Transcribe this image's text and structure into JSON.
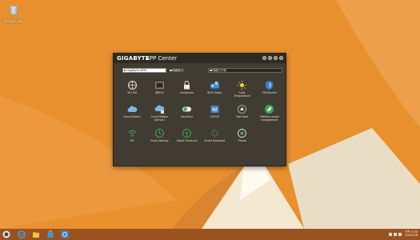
{
  "desktop": {
    "icons": [
      {
        "name": "recycle-bin-icon",
        "label": "Recycle Bin"
      }
    ],
    "wallpaper_colors": {
      "orange": "#e9902e",
      "cream": "#f6ecd8",
      "white": "#fffaf0"
    }
  },
  "window": {
    "brand": "GIGABYTE",
    "title": "APP Center",
    "controls": [
      "settings",
      "help",
      "minimize",
      "close"
    ],
    "filter": {
      "dropdown_value": "Gigabyte APPs",
      "options": [
        "隱藏程式",
        "隱藏已升級"
      ]
    },
    "apps": [
      [
        {
          "icon": "film-reel-icon",
          "label": "3D OSD"
        },
        {
          "icon": "bios-chip-icon",
          "label": "@BIOS"
        },
        {
          "icon": "padlock-icon",
          "label": "AutoGreen"
        },
        {
          "icon": "bios-setup-icon",
          "label": "BIOS Setup"
        },
        {
          "icon": "sun-temperature-icon",
          "label": "Color\nTemperature"
        },
        {
          "icon": "shield-icon",
          "label": "EIN Blocker"
        }
      ],
      [
        {
          "icon": "cloud-icon",
          "label": "Cloud Station"
        },
        {
          "icon": "cloud-server-icon",
          "label": "Cloud Station\n(Server)"
        },
        {
          "icon": "toggle-icon",
          "label": "EasyTune"
        },
        {
          "icon": "ez-icon",
          "label": "LIVEUD"
        },
        {
          "icon": "fast-boot-icon",
          "label": "Fast Boot"
        },
        {
          "icon": "leaf-icon",
          "label": "Platform power\nmanagement"
        }
      ],
      [
        {
          "icon": "wifi-icon",
          "label": "EFI"
        },
        {
          "icon": "smart-backup-icon",
          "label": "Smart Backup"
        },
        {
          "icon": "smart-timelock-icon",
          "label": "Smart TimeLock"
        },
        {
          "icon": "smart-keyboard-icon",
          "label": "Smart Keyboard"
        },
        {
          "icon": "power-icon",
          "label": "7Tunes"
        }
      ]
    ]
  },
  "taskbar": {
    "buttons": [
      "start-icon",
      "ie-icon",
      "file-explorer-icon",
      "store-icon",
      "app-center-icon"
    ],
    "clock": {
      "time": "下午 3:35",
      "date": "2015/2/6"
    }
  }
}
